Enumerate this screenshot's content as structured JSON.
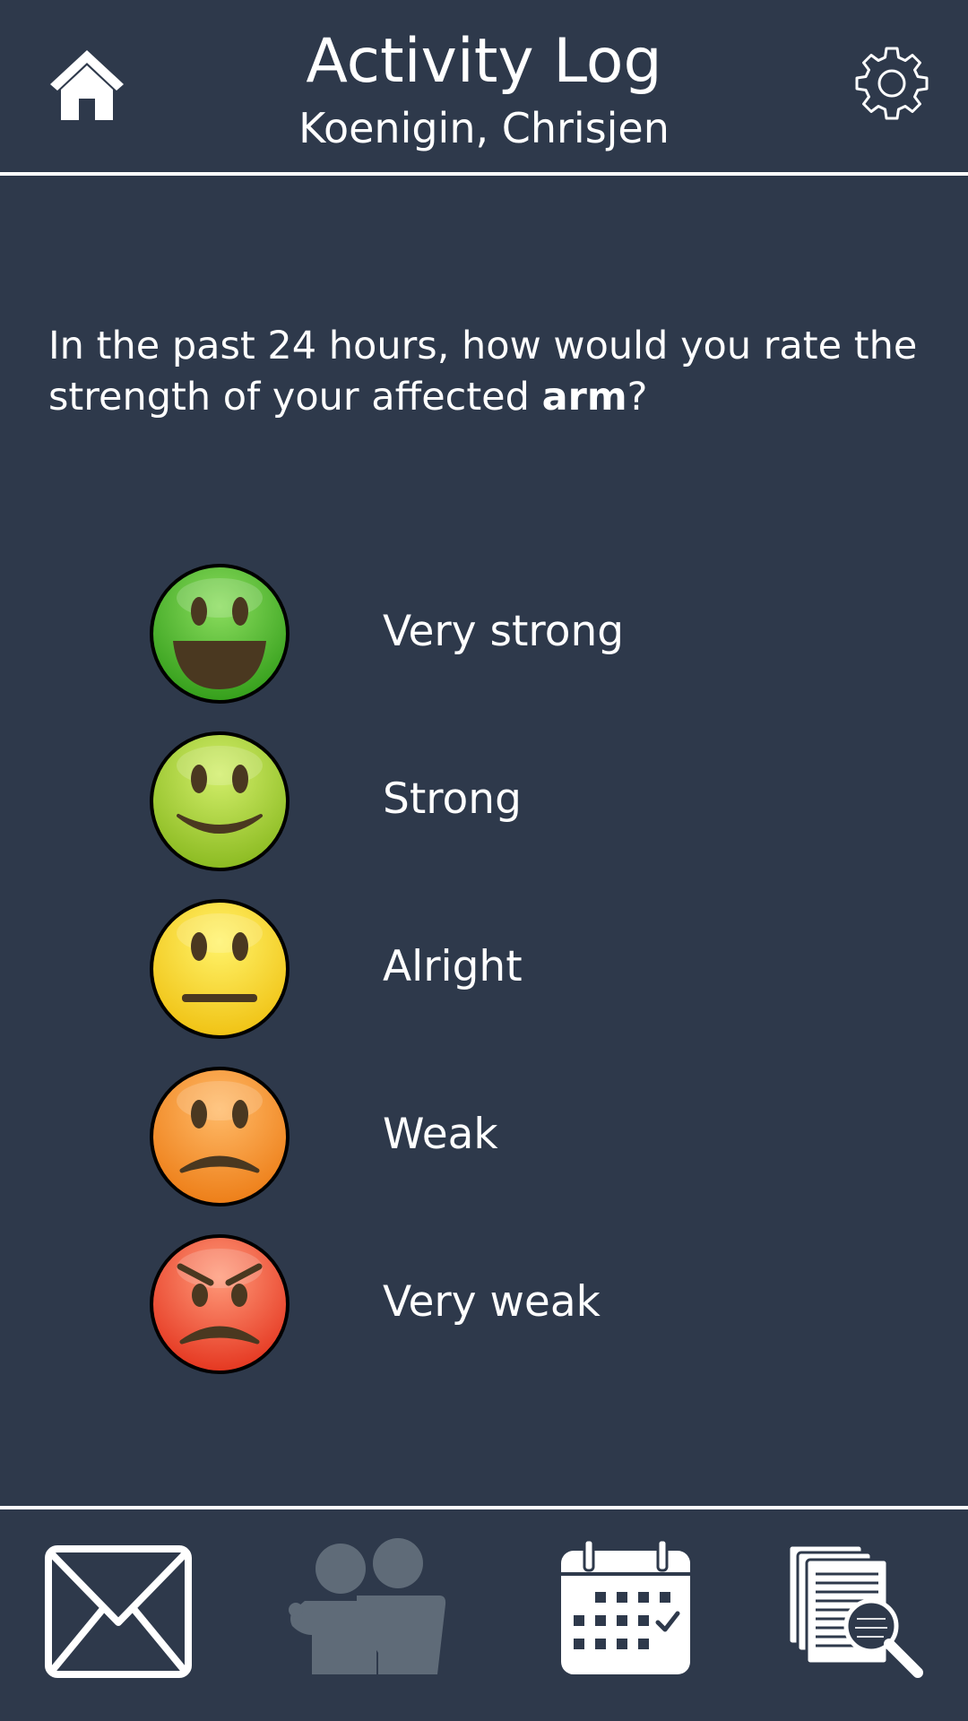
{
  "header": {
    "title": "Activity Log",
    "subtitle": "Koenigin, Chrisjen",
    "home_icon": "home-icon",
    "settings_icon": "gear-icon"
  },
  "question": {
    "prefix": "In the past 24 hours, how would you rate the strength of your affected ",
    "emphasis": "arm",
    "suffix": "?"
  },
  "options": [
    {
      "label": "Very strong",
      "icon": "very-happy-face-icon",
      "color": "#4caf2a"
    },
    {
      "label": "Strong",
      "icon": "happy-face-icon",
      "color": "#9ccc22"
    },
    {
      "label": "Alright",
      "icon": "neutral-face-icon",
      "color": "#f2d318"
    },
    {
      "label": "Weak",
      "icon": "sad-face-icon",
      "color": "#f08a1c"
    },
    {
      "label": "Very weak",
      "icon": "angry-face-icon",
      "color": "#e8361e"
    }
  ],
  "bottom_nav": [
    {
      "icon": "mail-icon",
      "active": true
    },
    {
      "icon": "people-icon",
      "active": false
    },
    {
      "icon": "calendar-icon",
      "active": true
    },
    {
      "icon": "documents-search-icon",
      "active": true
    }
  ],
  "colors": {
    "background": "#2e394b",
    "foreground": "#ffffff",
    "inactive_icon": "#5f6b78"
  }
}
